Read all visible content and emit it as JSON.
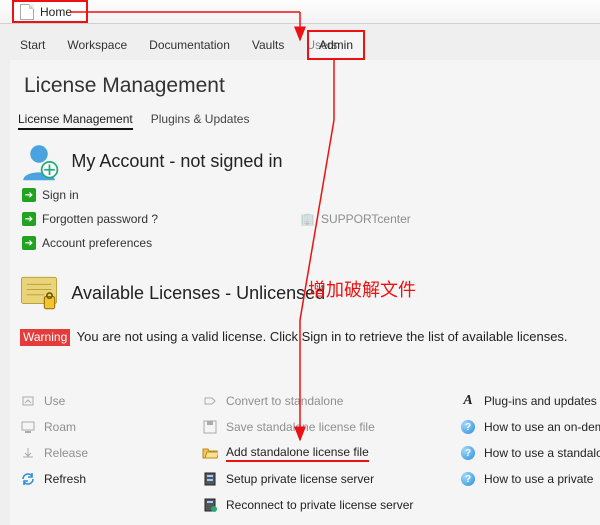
{
  "titlebar": {
    "home": "Home"
  },
  "nav": {
    "start": "Start",
    "workspace": "Workspace",
    "documentation": "Documentation",
    "vaults": "Vaults",
    "users": "Users",
    "admin": "Admin"
  },
  "page": {
    "heading": "License Management",
    "subtab_active": "License Management",
    "subtab_other": "Plugins & Updates"
  },
  "account": {
    "title": "My Account - not signed in",
    "sign_in": "Sign in",
    "forgotten": "Forgotten password ?",
    "prefs": "Account preferences",
    "support": "SUPPORTcenter"
  },
  "licenses": {
    "title": "Available Licenses - Unlicensed",
    "warning_label": "Warning",
    "warning_text": "You are not using a valid license. Click Sign in to retrieve the list of available licenses."
  },
  "colA": {
    "use": "Use",
    "roam": "Roam",
    "release": "Release",
    "refresh": "Refresh"
  },
  "colB": {
    "convert": "Convert to standalone",
    "save": "Save standalone license file",
    "add": "Add standalone license file",
    "setup": "Setup private license server",
    "reconnect": "Reconnect to private license server"
  },
  "colC": {
    "plugins": "Plug-ins and updates",
    "ondem": "How to use an on-dem",
    "standalone": "How to use a standalo",
    "private": "How to use a private"
  },
  "annotation": {
    "text": "增加破解文件"
  }
}
